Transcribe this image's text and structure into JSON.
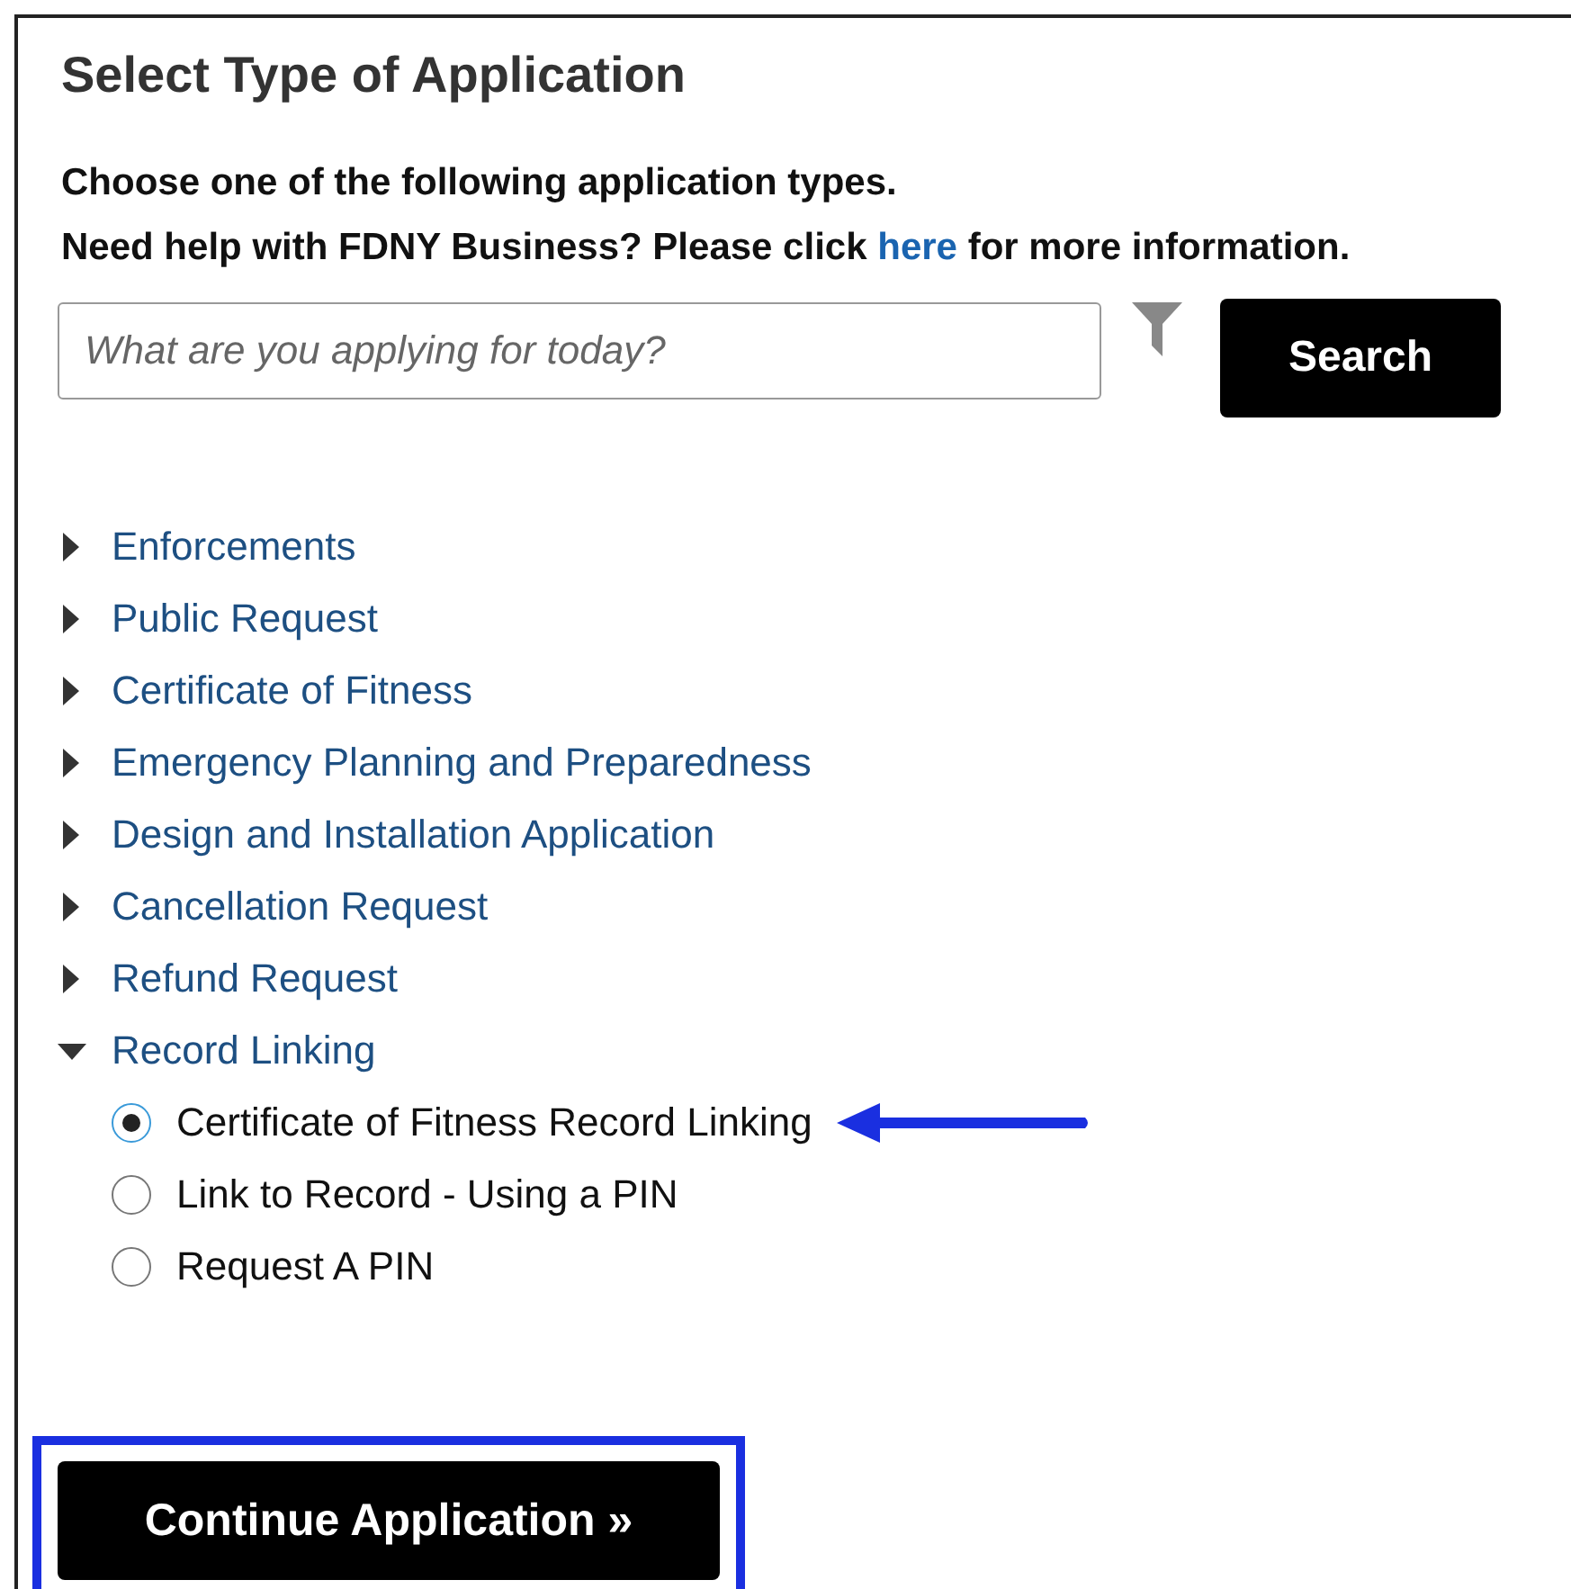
{
  "title": "Select Type of Application",
  "intro": "Choose one of the following application types.",
  "help": {
    "before": "Need help with FDNY Business? Please click",
    "link": "here",
    "after": "for more information."
  },
  "search": {
    "placeholder": "What are you applying for today?",
    "button": "Search"
  },
  "categories": [
    {
      "label": "Enforcements",
      "expanded": false
    },
    {
      "label": "Public Request",
      "expanded": false
    },
    {
      "label": "Certificate of Fitness",
      "expanded": false
    },
    {
      "label": "Emergency Planning and Preparedness",
      "expanded": false
    },
    {
      "label": "Design and Installation Application",
      "expanded": false
    },
    {
      "label": "Cancellation Request",
      "expanded": false
    },
    {
      "label": "Refund Request",
      "expanded": false
    },
    {
      "label": "Record Linking",
      "expanded": true,
      "options": [
        {
          "label": "Certificate of Fitness Record Linking",
          "selected": true
        },
        {
          "label": "Link to Record - Using a PIN",
          "selected": false
        },
        {
          "label": "Request A PIN",
          "selected": false
        }
      ]
    }
  ],
  "continue_button": "Continue Application »"
}
